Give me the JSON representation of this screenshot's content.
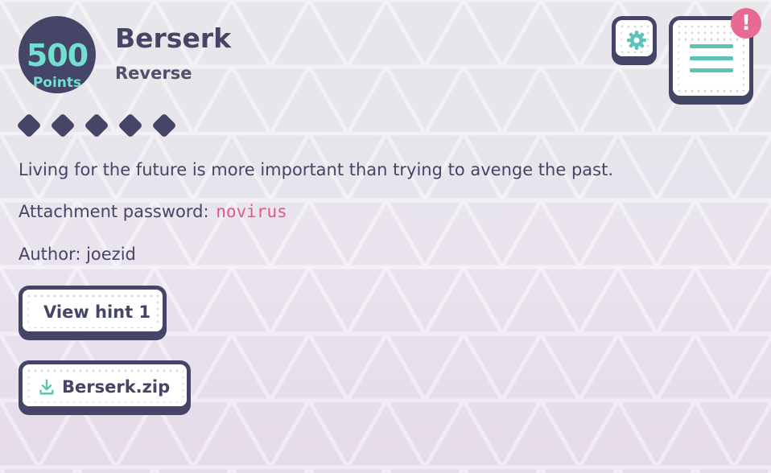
{
  "challenge": {
    "points_value": "500",
    "points_label": "Points",
    "title": "Berserk",
    "category": "Reverse",
    "difficulty_level": 5,
    "description": "Living for the future is more important than trying to avenge the past.",
    "password_label": "Attachment password:",
    "password_value": "novirus",
    "author_line": "Author: joezid"
  },
  "actions": {
    "hint_label": "View hint 1",
    "attachment_label": "Berserk.zip"
  },
  "toolbar": {
    "alert_symbol": "!",
    "gear_icon": "gear-icon",
    "menu_icon": "hamburger-menu-icon",
    "download_icon": "download-icon"
  },
  "colors": {
    "primary": "#454567",
    "accent": "#72e0d0",
    "teal": "#5cc3b7",
    "password": "#e8558a",
    "alert": "#e86a92"
  }
}
